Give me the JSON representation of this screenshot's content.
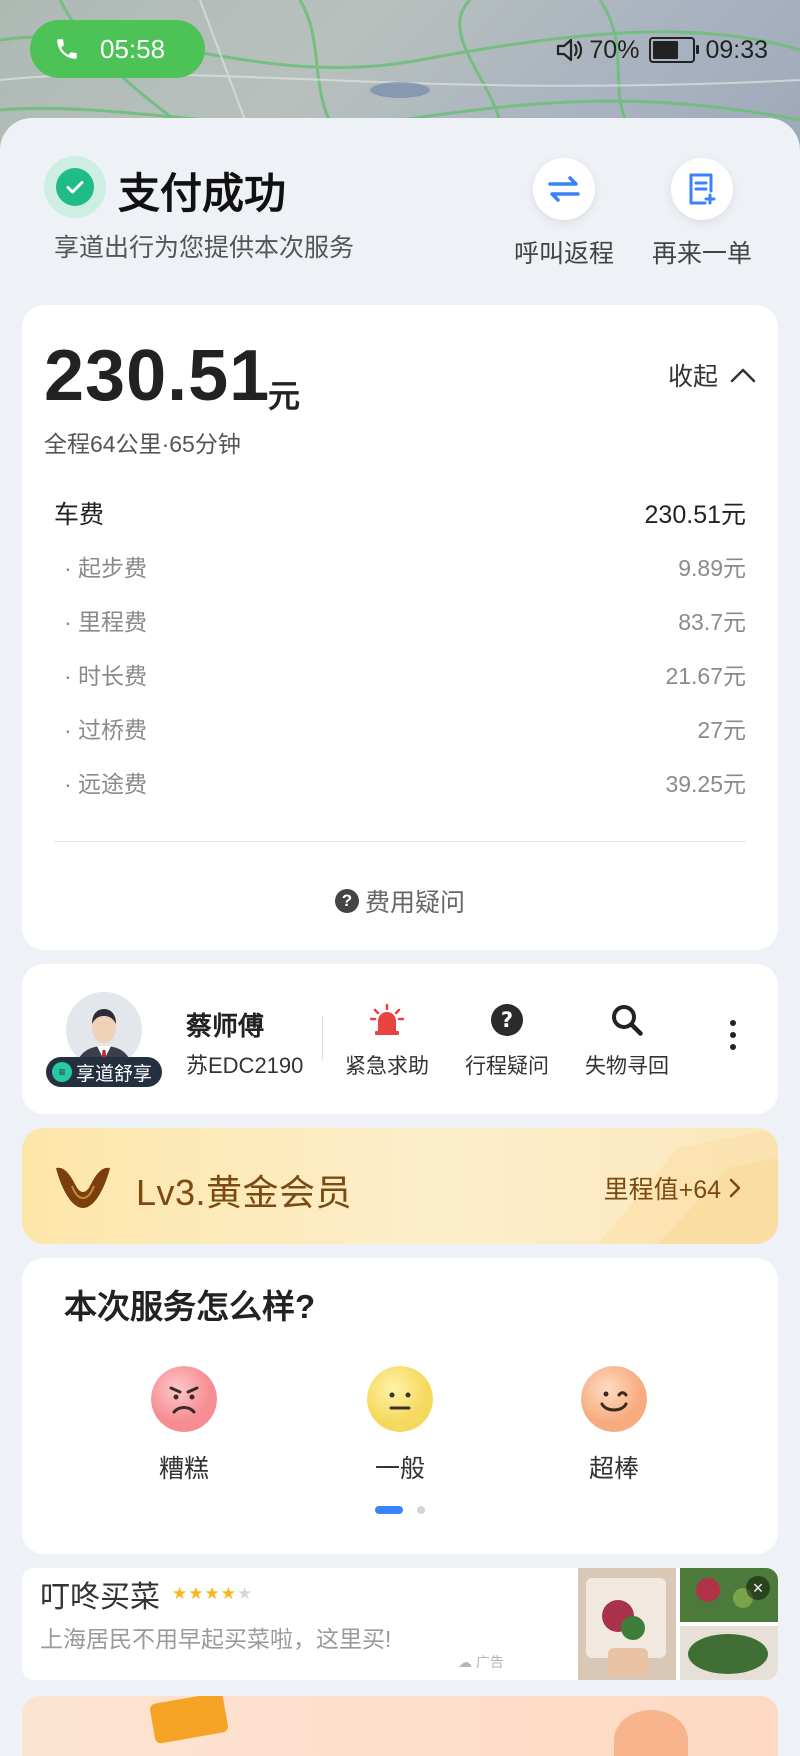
{
  "status_bar": {
    "call_time": "05:58",
    "volume_pct": "70%",
    "time": "09:33"
  },
  "header": {
    "title": "支付成功",
    "subtitle": "享道出行为您提供本次服务",
    "actions": [
      {
        "label": "呼叫返程",
        "icon": "swap-arrows-icon"
      },
      {
        "label": "再来一单",
        "icon": "reorder-doc-icon"
      }
    ]
  },
  "fare": {
    "amount": "230.51",
    "unit": "元",
    "trip_meta": "全程64公里·65分钟",
    "collapse_label": "收起",
    "main_label": "车费",
    "main_value": "230.51元",
    "items": [
      {
        "name": "· 起步费",
        "value": "9.89元"
      },
      {
        "name": "· 里程费",
        "value": "83.7元"
      },
      {
        "name": "· 时长费",
        "value": "21.67元"
      },
      {
        "name": "· 过桥费",
        "value": "27元"
      },
      {
        "name": "· 远途费",
        "value": "39.25元"
      }
    ],
    "question_label": "费用疑问"
  },
  "driver": {
    "badge": "享道舒享",
    "name": "蔡师傅",
    "plate": "苏EDC2190",
    "actions": [
      {
        "label": "紧急求助",
        "icon": "alarm-icon"
      },
      {
        "label": "行程疑问",
        "icon": "question-icon"
      },
      {
        "label": "失物寻回",
        "icon": "search-icon"
      }
    ]
  },
  "membership": {
    "level": "Lv3.黄金会员",
    "points": "里程值+64"
  },
  "rating": {
    "title": "本次服务怎么样?",
    "options": [
      {
        "label": "糟糕",
        "color": "#f7a3a6"
      },
      {
        "label": "一般",
        "color": "#f7e07a"
      },
      {
        "label": "超棒",
        "color": "#f8b98c"
      }
    ]
  },
  "ad": {
    "title": "叮咚买菜",
    "stars": "★★★★",
    "star_off": "★",
    "desc": "上海居民不用早起买菜啦，这里买!",
    "tag": "广告"
  },
  "colors": {
    "success": "#1fbc85",
    "call_green": "#4cc257",
    "link_blue": "#3b82f6",
    "gold_text": "#7a4a10"
  }
}
